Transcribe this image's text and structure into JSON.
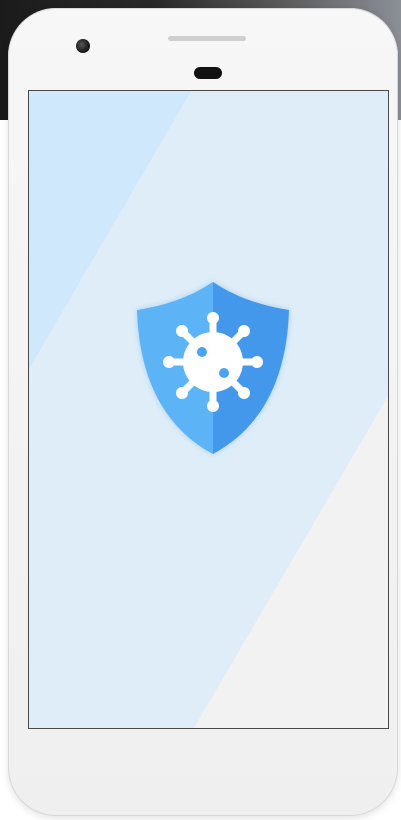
{
  "app": {
    "icon": "shield-virus-icon",
    "accent_color": "#4aa3f0"
  }
}
